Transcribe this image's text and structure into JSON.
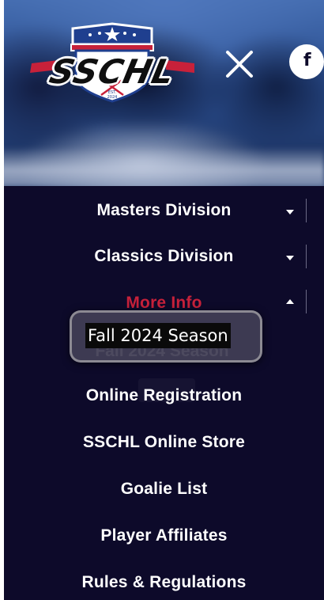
{
  "header": {
    "logo_text": "SSCHL",
    "logo_est": "EST.",
    "logo_year": "2024",
    "close_icon": "close-icon",
    "facebook_icon": "facebook-icon",
    "facebook_glyph": "f"
  },
  "menu": {
    "items": [
      {
        "label": "Masters Division",
        "has_dropdown": true,
        "expanded": false
      },
      {
        "label": "Classics Division",
        "has_dropdown": true,
        "expanded": false
      },
      {
        "label": "More Info",
        "has_dropdown": true,
        "expanded": true,
        "active": true
      }
    ],
    "submenu": [
      {
        "label": "Fall 2024 Season"
      },
      {
        "label": "Online Registration"
      },
      {
        "label": "SSCHL Online Store"
      },
      {
        "label": "Goalie List"
      },
      {
        "label": "Player Affiliates"
      },
      {
        "label": "Rules & Regulations"
      }
    ]
  },
  "tooltip": {
    "text": "Fall 2024 Season"
  },
  "colors": {
    "menu_background": "#0d0a2a",
    "active_text": "#c7213a",
    "menu_text": "#ffffff",
    "logo_blue": "#1f3f8f",
    "logo_red": "#c7213a"
  }
}
